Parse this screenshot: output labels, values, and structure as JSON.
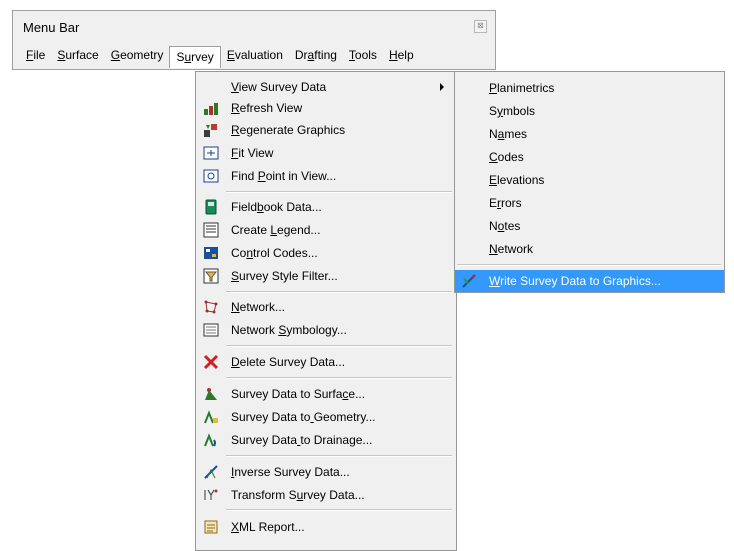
{
  "menubar": {
    "title": "Menu Bar",
    "close_glyph": "⊠",
    "menus": [
      "File",
      "Surface",
      "Geometry",
      "Survey",
      "Evaluation",
      "Drafting",
      "Tools",
      "Help"
    ],
    "open_menu": "Survey"
  },
  "survey_menu": {
    "items": [
      {
        "label": "View Survey Data",
        "icon": "none",
        "has_submenu": true
      },
      {
        "label": "Refresh View",
        "icon": "refresh-view-icon"
      },
      {
        "label": "Regenerate Graphics",
        "icon": "regenerate-graphics-icon"
      },
      {
        "label": "Fit View",
        "icon": "fit-view-icon"
      },
      {
        "label": "Find Point in View...",
        "icon": "find-point-icon"
      },
      {
        "label": "Fieldbook Data...",
        "icon": "fieldbook-icon"
      },
      {
        "label": "Create Legend...",
        "icon": "legend-icon"
      },
      {
        "label": "Control Codes...",
        "icon": "control-codes-icon"
      },
      {
        "label": "Survey Style Filter...",
        "icon": "style-filter-icon"
      },
      {
        "label": "Network...",
        "icon": "network-icon"
      },
      {
        "label": "Network Symbology...",
        "icon": "network-symbology-icon"
      },
      {
        "label": "Delete Survey Data...",
        "icon": "delete-icon"
      },
      {
        "label": "Survey Data to Surface...",
        "icon": "to-surface-icon"
      },
      {
        "label": "Survey Data to Geometry...",
        "icon": "to-geometry-icon"
      },
      {
        "label": "Survey Data to Drainage...",
        "icon": "to-drainage-icon"
      },
      {
        "label": "Inverse Survey Data...",
        "icon": "inverse-icon"
      },
      {
        "label": "Transform Survey Data...",
        "icon": "transform-icon"
      },
      {
        "label": "XML Report...",
        "icon": "xml-report-icon"
      }
    ]
  },
  "view_submenu": {
    "items": [
      {
        "label": "Planimetrics"
      },
      {
        "label": "Symbols"
      },
      {
        "label": "Names"
      },
      {
        "label": "Codes"
      },
      {
        "label": "Elevations"
      },
      {
        "label": "Errors"
      },
      {
        "label": "Notes"
      },
      {
        "label": "Network"
      },
      {
        "label": "Write Survey Data to Graphics...",
        "icon": "write-graphics-icon",
        "highlighted": true
      }
    ]
  },
  "colors": {
    "menu_bg": "#f0f0f0",
    "highlight": "#3399ff",
    "border": "#979797"
  }
}
